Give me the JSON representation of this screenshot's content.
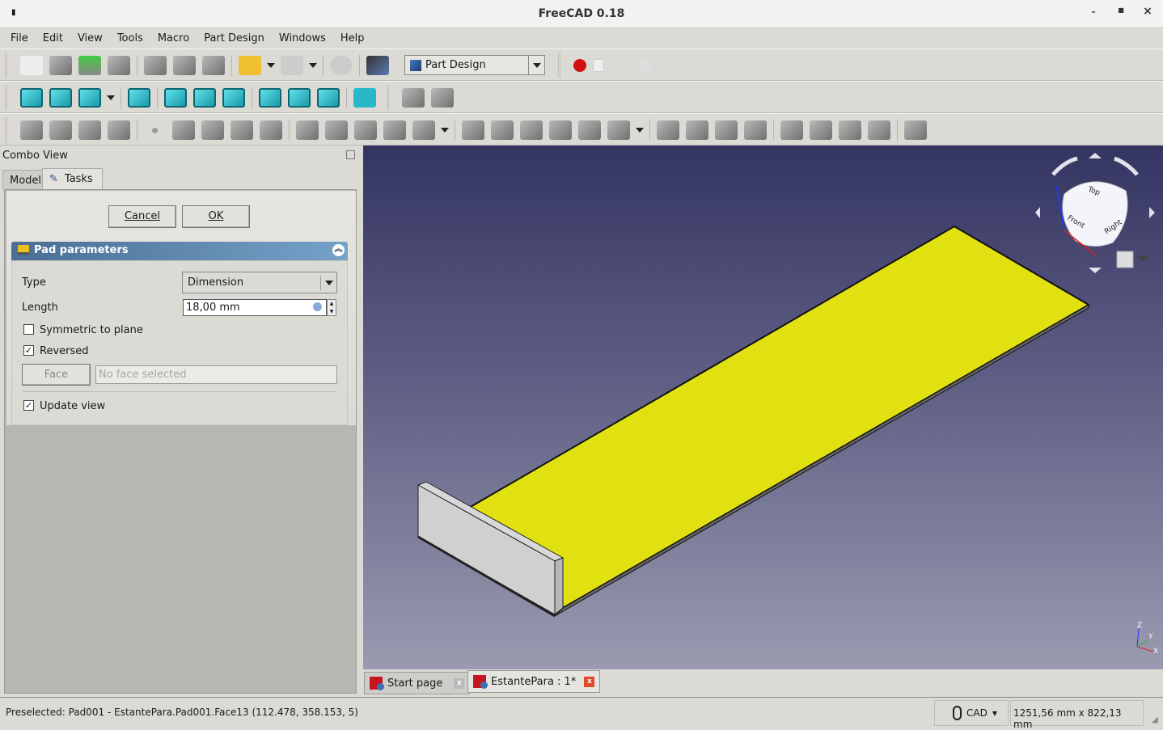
{
  "window": {
    "title": "FreeCAD 0.18",
    "minimize": "–",
    "maximize": "■",
    "close": "×"
  },
  "menu": [
    "File",
    "Edit",
    "View",
    "Tools",
    "Macro",
    "Part Design",
    "Windows",
    "Help"
  ],
  "toolbar": {
    "file": [
      "new-document-icon",
      "open-icon",
      "save-icon",
      "print-icon",
      "|",
      "cut-icon",
      "copy-icon",
      "paste-icon",
      "|",
      "undo-icon",
      "v",
      "redo-icon",
      "v",
      "|",
      "refresh-icon",
      "|",
      "whats-this-icon"
    ],
    "workbench": "Part Design",
    "macro": [
      "record-macro-icon",
      "stop-macro-icon",
      "macro-editor-icon",
      "run-macro-icon"
    ],
    "view": [
      "fit-all-icon",
      "fit-selection-icon",
      "draw-style-icon",
      "v",
      "|",
      "isometric-view-icon",
      "|",
      "front-view-icon",
      "top-view-icon",
      "right-view-icon",
      "|",
      "rear-view-icon",
      "bottom-view-icon",
      "left-view-icon",
      "|",
      "measure-distance-icon"
    ],
    "structure": [
      "create-part-icon",
      "create-group-icon"
    ],
    "partdesign": [
      "create-body-icon",
      "create-sketch-icon",
      "validate-sketch-icon",
      "shape-binder-icon",
      "|",
      "datum-point-icon",
      "datum-line-icon",
      "datum-plane-icon",
      "sub-shape-binder-icon",
      "clone-icon",
      "|",
      "pad-icon",
      "revolution-icon",
      "loft-icon",
      "pipe-icon",
      "additive-primitive-icon",
      "v",
      "|",
      "pocket-icon",
      "hole-icon",
      "groove-icon",
      "subtractive-loft-icon",
      "subtractive-pipe-icon",
      "subtractive-primitive-icon",
      "v",
      "|",
      "mirrored-icon",
      "linear-pattern-icon",
      "polar-pattern-icon",
      "multi-transform-icon",
      "|",
      "fillet-icon",
      "chamfer-icon",
      "draft-icon",
      "thickness-icon",
      "|",
      "boolean-icon"
    ]
  },
  "combo": {
    "title": "Combo View",
    "tabs": {
      "model": "Model",
      "tasks": "Tasks"
    }
  },
  "task": {
    "cancel": "Cancel",
    "ok": "OK",
    "panel_title": "Pad parameters",
    "type_label": "Type",
    "type_value": "Dimension",
    "length_label": "Length",
    "length_value": "18,00 mm",
    "symmetric_label": "Symmetric to plane",
    "symmetric_checked": false,
    "reversed_label": "Reversed",
    "reversed_checked": true,
    "face_button": "Face",
    "face_placeholder": "No face selected",
    "update_label": "Update view",
    "update_checked": true
  },
  "viewport": {
    "navcube": {
      "top": "Top",
      "front": "Front",
      "right": "Right"
    },
    "axes": {
      "x": "X",
      "y": "Y",
      "z": "Z"
    },
    "pad_color": "#e1e112",
    "bg_top": "#343462",
    "bg_bottom": "#9a9ab0"
  },
  "doc_tabs": [
    {
      "label": "Start page"
    },
    {
      "label": "EstantePara : 1*"
    }
  ],
  "status": {
    "message": "Preselected: Pad001 - EstantePara.Pad001.Face13 (112.478, 358.153, 5)",
    "nav_style": "CAD",
    "dimensions": "1251,56 mm x 822,13 mm"
  }
}
